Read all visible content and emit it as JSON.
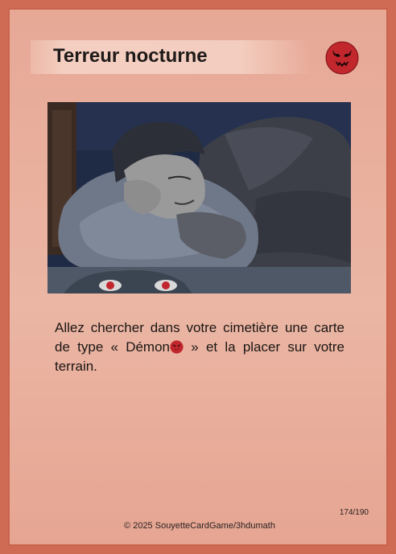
{
  "card": {
    "title": "Terreur nocturne",
    "type_icon": "demon-icon",
    "illustration": "sleeping-man-with-demon-eyes",
    "text_before": "Allez chercher dans votre cimetière une carte de type « Démon",
    "text_after": " » et la placer sur votre terrain.",
    "number": "174/190",
    "copyright": "© 2025 SouyetteCardGame/3hdumath"
  },
  "colors": {
    "border": "#cf6a55",
    "card_bg": "#ebb6a4",
    "demon_red": "#c1272d"
  }
}
